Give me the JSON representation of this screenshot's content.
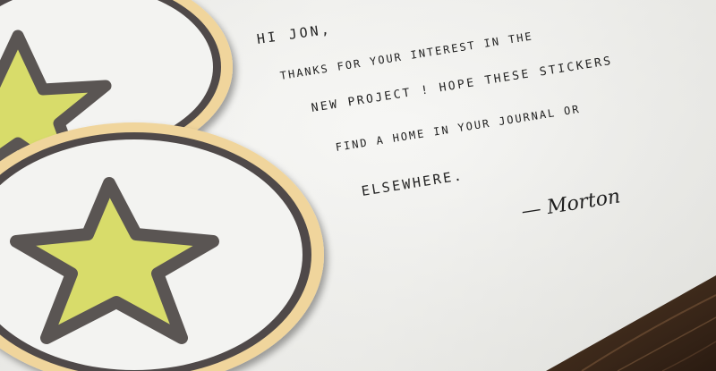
{
  "note": {
    "line1": "HI JON,",
    "line2": "THANKS FOR YOUR INTEREST IN THE",
    "line3": "NEW PROJECT ! HOPE THESE STICKERS",
    "line4": "FIND A HOME IN YOUR JOURNAL OR",
    "line5": "ELSEWHERE.",
    "signature": "— Morton"
  },
  "sticker": {
    "icon": "star-icon",
    "star_fill": "#d8dc6a",
    "star_outline": "#5a5452",
    "rim_color": "#f0d59c",
    "face_color": "#f3f3f1"
  },
  "colors": {
    "paper": "#f1f1ee",
    "ink": "#222222",
    "wood": "#3b2a1d"
  }
}
